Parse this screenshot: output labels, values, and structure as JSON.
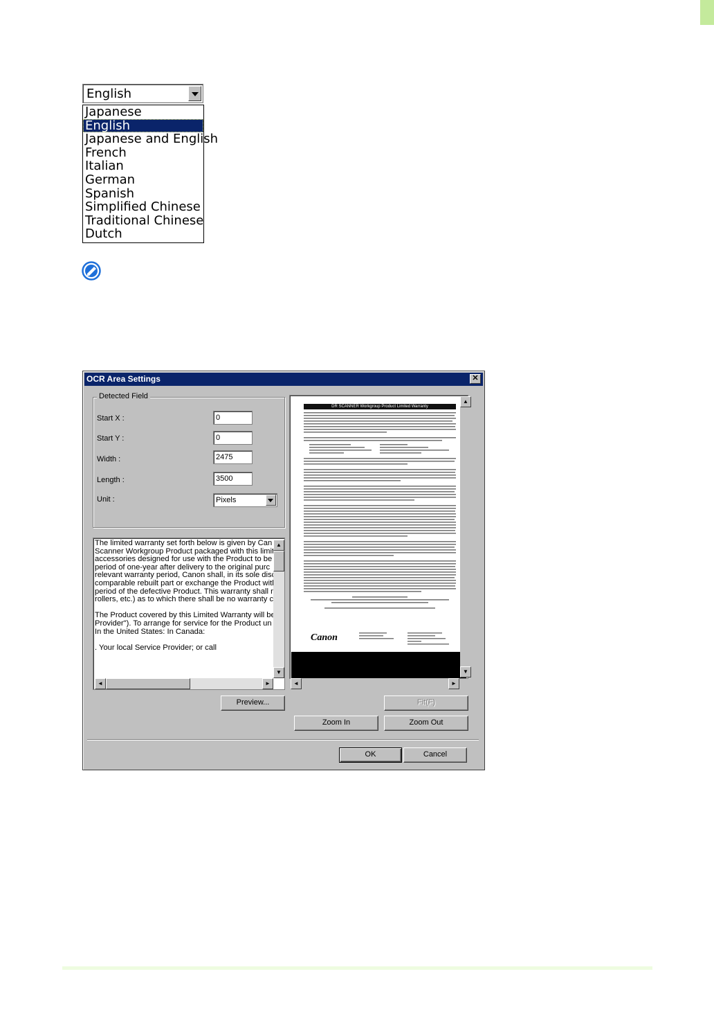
{
  "language_dropdown": {
    "selected": "English",
    "options": [
      "Japanese",
      "English",
      "Japanese and English",
      "French",
      "Italian",
      "German",
      "Spanish",
      "Simplified Chinese",
      "Traditional Chinese",
      "Dutch"
    ],
    "highlighted": "English"
  },
  "note_icon": "note-pencil-icon",
  "dialog": {
    "title": "OCR Area Settings",
    "close_label": "✕",
    "group_title": "Detected Field",
    "fields": {
      "start_x": {
        "label": "Start X :",
        "value": "0"
      },
      "start_y": {
        "label": "Start Y :",
        "value": "0"
      },
      "width": {
        "label": "Width :",
        "value": "2475"
      },
      "length": {
        "label": "Length :",
        "value": "3500"
      },
      "unit": {
        "label": "Unit :",
        "value": "Pixels"
      }
    },
    "ocr_text": "The limited warranty set forth below is given by Can\nScanner Workgroup Product packaged with this limite\naccessories designed for use with the Product to be\nperiod of one-year after delivery to the original purc\nrelevant warranty period, Canon shall, in its sole disc\ncomparable rebuilt part or exchange the Product with\nperiod of the defective Product. This warranty shall n\nrollers, etc.) as to which there shall be no warranty c\n\nThe Product covered by this Limited Warranty will be\nProvider\"). To arrange for service for the Product un\nIn the United States: In Canada:\n\n. Your local Service Provider; or call",
    "preview_doc": {
      "header": "DR SCANNER Workgroup Product Limited Warranty",
      "brand": "Canon"
    },
    "buttons": {
      "preview": "Preview...",
      "fit": "Fit(F)",
      "zoom_in": "Zoom In",
      "zoom_out": "Zoom Out",
      "ok": "OK",
      "cancel": "Cancel"
    }
  }
}
